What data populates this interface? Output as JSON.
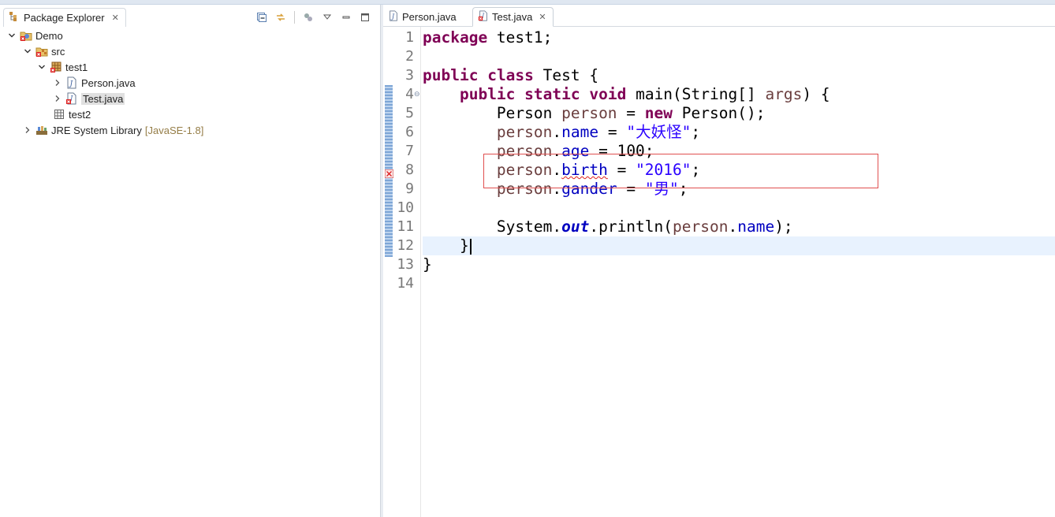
{
  "package_explorer": {
    "title": "Package Explorer",
    "tree": [
      {
        "label": "Demo",
        "icon": "java-project-error-icon",
        "expanded": true
      },
      {
        "label": "src",
        "icon": "source-folder-error-icon",
        "expanded": true
      },
      {
        "label": "test1",
        "icon": "package-error-icon",
        "expanded": true
      },
      {
        "label": "Person.java",
        "icon": "java-file-icon",
        "expanded": false
      },
      {
        "label": "Test.java",
        "icon": "java-file-error-icon",
        "expanded": false,
        "selected": true
      },
      {
        "label": "test2",
        "icon": "package-icon"
      },
      {
        "label": "JRE System Library",
        "decoration": "[JavaSE-1.8]",
        "icon": "library-icon",
        "expanded": false
      }
    ]
  },
  "editor": {
    "tabs": [
      {
        "label": "Person.java",
        "icon": "java-file-icon",
        "active": false
      },
      {
        "label": "Test.java",
        "icon": "java-file-error-icon",
        "active": true
      }
    ],
    "line_numbers": [
      "1",
      "2",
      "3",
      "4",
      "5",
      "6",
      "7",
      "8",
      "9",
      "10",
      "11",
      "12",
      "13",
      "14"
    ],
    "code": {
      "l1_kw": "package",
      "l1_rest": " test1;",
      "l3_kw1": "public",
      "l3_kw2": "class",
      "l3_rest": " Test {",
      "l4_kw1": "public",
      "l4_kw2": "static",
      "l4_kw3": "void",
      "l4_m": " main(String[] ",
      "l4_var": "args",
      "l4_end": ") {",
      "l5_type": "Person ",
      "l5_var": "person",
      "l5_eq": " = ",
      "l5_kw": "new",
      "l5_end": " Person();",
      "l6_var": "person",
      "l6_dot": ".",
      "l6_fld": "name",
      "l6_eq": " = ",
      "l6_str": "\"大妖怪\"",
      "l6_end": ";",
      "l7_var": "person",
      "l7_dot": ".",
      "l7_fld": "age",
      "l7_end": " = 100;",
      "l8_var": "person",
      "l8_dot": ".",
      "l8_fld": "birth",
      "l8_eq": " = ",
      "l8_str": "\"2016\"",
      "l8_end": ";",
      "l9_var": "person",
      "l9_dot": ".",
      "l9_fld": "gander",
      "l9_eq": " = ",
      "l9_str": "\"男\"",
      "l9_end": ";",
      "l11_a": "System.",
      "l11_sfld": "out",
      "l11_b": ".println(",
      "l11_var": "person",
      "l11_dot": ".",
      "l11_fld": "name",
      "l11_end": ");",
      "l12": "}",
      "l13": "}"
    }
  },
  "colors": {
    "keyword": "#7f0055",
    "local_var": "#6a3e3e",
    "field": "#0000c0",
    "string": "#2a00ff",
    "current_line": "#e8f2fe",
    "error_box": "#e05050"
  }
}
